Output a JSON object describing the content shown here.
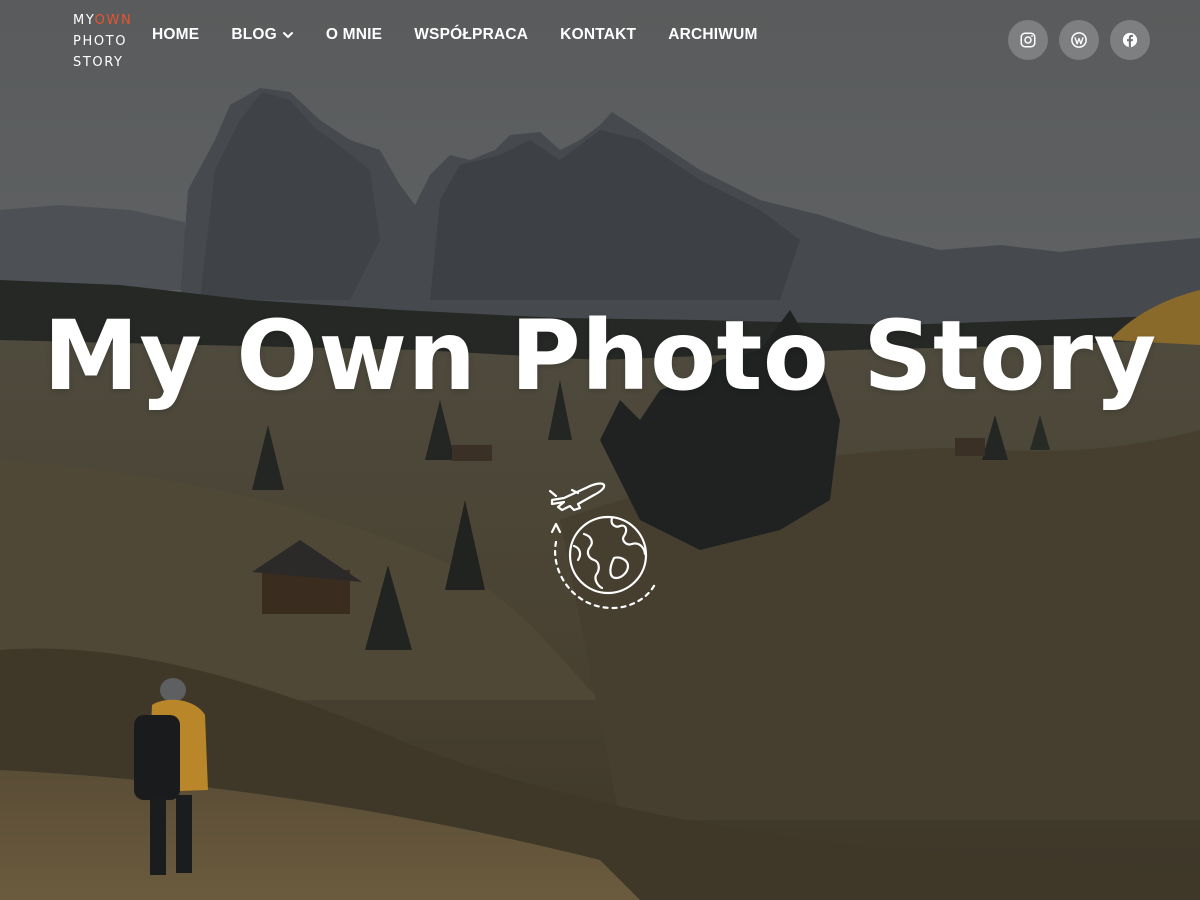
{
  "site": {
    "logo": {
      "line1_white": "MY",
      "line1_accent": "OWN",
      "line2": "PHOTO",
      "line3": "STORY"
    },
    "accent_color": "#e8542f"
  },
  "nav": {
    "items": [
      {
        "label": "HOME"
      },
      {
        "label": "BLOG",
        "has_dropdown": true
      },
      {
        "label": "O MNIE"
      },
      {
        "label": "WSPÓŁPRACA"
      },
      {
        "label": "KONTAKT"
      },
      {
        "label": "ARCHIWUM"
      }
    ]
  },
  "social": [
    {
      "icon": "instagram-icon"
    },
    {
      "icon": "wordpress-icon"
    },
    {
      "icon": "facebook-icon"
    }
  ],
  "hero": {
    "title": "My Own Photo Story",
    "emblem_icon": "travel-globe-airplane-icon"
  }
}
